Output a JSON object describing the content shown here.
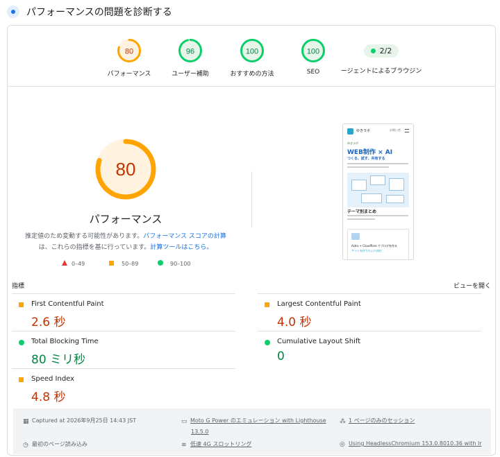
{
  "header": {
    "title": "パフォーマンスの問題を診断する",
    "icon": "lighthouse-icon"
  },
  "colors": {
    "fail": "#e53935",
    "average": "#ffa400",
    "pass": "#0cce6b",
    "average_text": "#c33300",
    "pass_text": "#018642",
    "link": "#1a73e8"
  },
  "categories": [
    {
      "score": "80",
      "score_value": 80,
      "label": "パフォーマンス",
      "rating": "average"
    },
    {
      "score": "96",
      "score_value": 96,
      "label": "ユーザー補助",
      "rating": "pass"
    },
    {
      "score": "100",
      "score_value": 100,
      "label": "おすすめの方法",
      "rating": "pass"
    },
    {
      "score": "100",
      "score_value": 100,
      "label": "SEO",
      "rating": "pass"
    }
  ],
  "pwa": {
    "value": "2/2",
    "label": "ージェントによるブラウジン"
  },
  "main_gauge": {
    "score": "80",
    "score_value": 80,
    "title": "パフォーマンス"
  },
  "description": {
    "text1": "推定値のため変動する可能性があります。",
    "link1": "パフォーマンス スコアの計算",
    "text2": "は、これらの指標を基に行っています。",
    "link2": "計算ツールはこちら。"
  },
  "legend": [
    {
      "range": "0–49",
      "shape": "triangle"
    },
    {
      "range": "50–89",
      "shape": "square"
    },
    {
      "range": "90–100",
      "shape": "circle"
    }
  ],
  "screenshot": {
    "site_name": "ゆきラボ",
    "nav_label": "お問い合",
    "tag": "ゆきラボ",
    "headline": "WEB制作 × AI",
    "subheadline": "つくる、試す、共有する",
    "section_title": "テーマ別まとめ",
    "card_title": "Astro + Cloudflare でブログを作る",
    "card_sub": "サイトを作りたい人向け"
  },
  "metrics_section": {
    "title": "指標",
    "expand_label": "ビューを開く"
  },
  "metrics": [
    {
      "name": "First Contentful Paint",
      "value": "2.6 秒",
      "rating": "average"
    },
    {
      "name": "Largest Contentful Paint",
      "value": "4.0 秒",
      "rating": "average"
    },
    {
      "name": "Total Blocking Time",
      "value": "80 ミリ秒",
      "rating": "pass"
    },
    {
      "name": "Cumulative Layout Shift",
      "value": "0",
      "rating": "pass"
    },
    {
      "name": "Speed Index",
      "value": "4.8 秒",
      "rating": "average"
    }
  ],
  "footer": {
    "captured": "Captured at 2026年9月25日 14:43 JST",
    "device": "Moto G Power のエミュレーション with Lighthouse",
    "device_version": "13.5.0",
    "session": "1 ページのみのセッション",
    "load": "最初のページ読み込み",
    "network": "低速 4G スロットリング",
    "browser": "Using HeadlessChromium 153.0.8010.36 with lr"
  }
}
